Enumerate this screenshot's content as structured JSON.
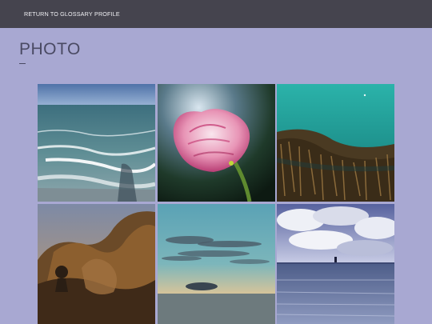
{
  "nav": {
    "items": [
      {
        "label": "RETURN TO GLOSSARY"
      },
      {
        "label": "PROFILE"
      }
    ]
  },
  "page": {
    "title": "PHOTO"
  },
  "colors": {
    "background": "#a8a8d2",
    "topbar": "#45444e",
    "nav_text": "#f2f2f6",
    "title_text": "#4a4a63"
  },
  "gallery": {
    "photos": [
      {
        "subject": "beach-waves"
      },
      {
        "subject": "pink-tulip"
      },
      {
        "subject": "underwater-seaweed"
      },
      {
        "subject": "desert-bush-sunset"
      },
      {
        "subject": "sunset-clouds-over-sea"
      },
      {
        "subject": "cloudy-sea-horizon"
      }
    ]
  }
}
